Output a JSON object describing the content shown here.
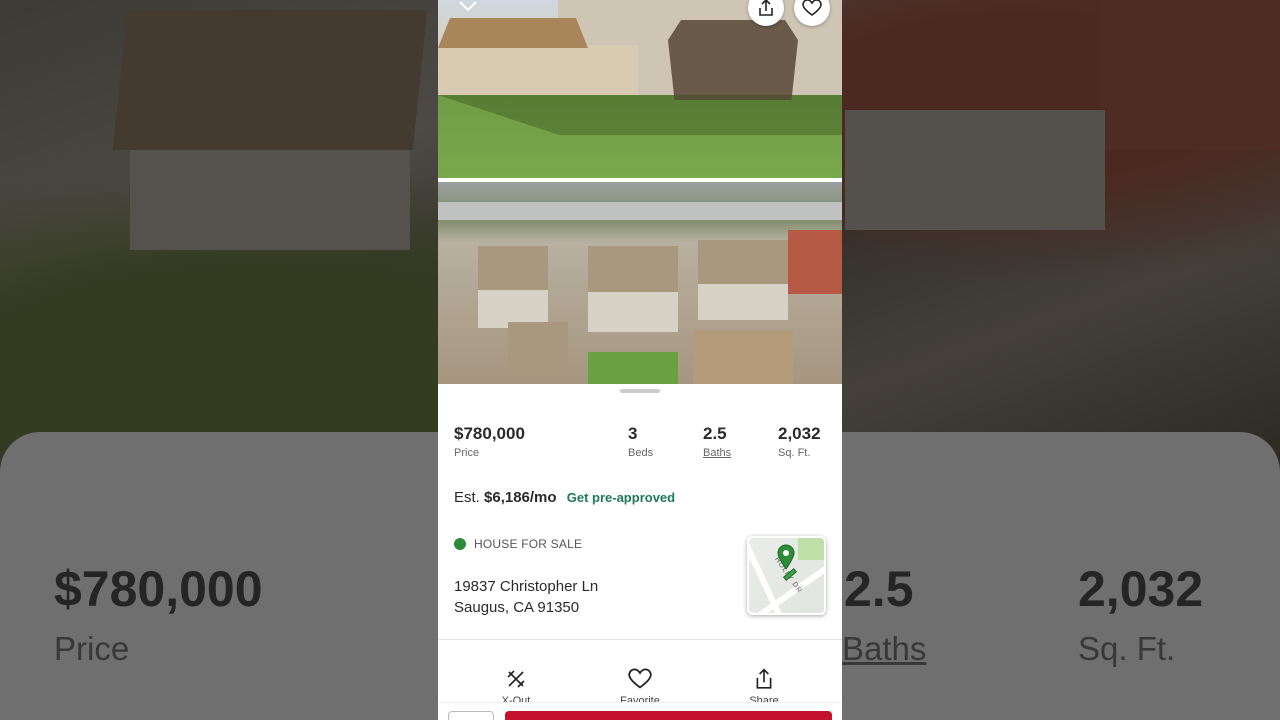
{
  "listing": {
    "price": "$780,000",
    "price_label": "Price",
    "beds": "3",
    "beds_label": "Beds",
    "baths": "2.5",
    "baths_label": "Baths",
    "sqft": "2,032",
    "sqft_label": "Sq. Ft.",
    "est_prefix": "Est.",
    "est_monthly": "$6,186/mo",
    "preapproved_link": "Get pre-approved",
    "status": "HOUSE FOR SALE",
    "status_color": "#2e8b3a",
    "address_line1": "19837 Christopher Ln",
    "address_line2": "Saugus, CA 91350"
  },
  "map": {
    "street_label": "HOLLY DR",
    "pin_color": "#2e8b3a"
  },
  "actions": {
    "xout": "X-Out",
    "favorite": "Favorite",
    "share": "Share"
  },
  "colors": {
    "accent": "#c4122f",
    "link": "#1f7a5a"
  },
  "icons": {
    "back": "chevron-down-icon",
    "share": "share-icon",
    "favorite": "heart-icon",
    "xout": "x-out-icon"
  }
}
